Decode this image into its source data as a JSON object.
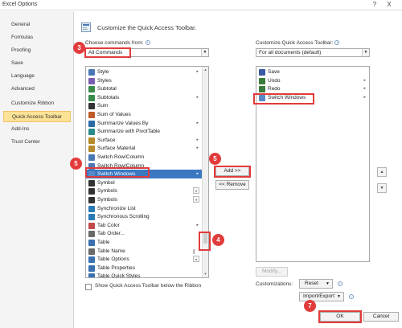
{
  "window": {
    "title": "Excel Options",
    "help_icon": "?",
    "close_icon": "X"
  },
  "sidebar": {
    "items": [
      {
        "label": "General"
      },
      {
        "label": "Formulas"
      },
      {
        "label": "Proofing"
      },
      {
        "label": "Save"
      },
      {
        "label": "Language"
      },
      {
        "label": "Advanced"
      },
      {
        "label": "Customize Ribbon"
      },
      {
        "label": "Quick Access Toolbar",
        "active": true
      },
      {
        "label": "Add-Ins"
      },
      {
        "label": "Trust Center"
      }
    ]
  },
  "header": {
    "title": "Customize the Quick Access Toolbar."
  },
  "left": {
    "choose_label": "Choose commands from:",
    "choose_value": "All Commands",
    "commands": [
      {
        "label": "Style",
        "icon": "style-icon",
        "sub": "▸"
      },
      {
        "label": "Styles",
        "icon": "styles-icon",
        "sub": ""
      },
      {
        "label": "Subtotal",
        "icon": "subtotal-icon",
        "sub": ""
      },
      {
        "label": "Subtotals",
        "icon": "subtotals-icon",
        "sub": "▸"
      },
      {
        "label": "Sum",
        "icon": "sum-icon",
        "sub": ""
      },
      {
        "label": "Sum of Values",
        "icon": "sum-values-icon",
        "sub": ""
      },
      {
        "label": "Summarize Values By",
        "icon": "summarize-icon",
        "sub": "▸"
      },
      {
        "label": "Summarize with PivotTable",
        "icon": "pivot-icon",
        "sub": ""
      },
      {
        "label": "Surface",
        "icon": "surface-icon",
        "sub": "▸"
      },
      {
        "label": "Surface Material",
        "icon": "surface-material-icon",
        "sub": "▸"
      },
      {
        "label": "Switch Row/Column",
        "icon": "switch-row-col-icon",
        "sub": ""
      },
      {
        "label": "Switch Row/Column",
        "icon": "switch-row-col-icon",
        "sub": ""
      },
      {
        "label": "Switch Windows",
        "icon": "switch-windows-icon",
        "sub": "▸",
        "selected": true
      },
      {
        "label": "Symbol",
        "icon": "symbol-icon",
        "sub": ""
      },
      {
        "label": "Symbols",
        "icon": "symbols-icon",
        "sub": "▾"
      },
      {
        "label": "Symbols",
        "icon": "symbols-icon",
        "sub": "▾"
      },
      {
        "label": "Synchronize List",
        "icon": "sync-list-icon",
        "sub": ""
      },
      {
        "label": "Synchronous Scrolling",
        "icon": "sync-scroll-icon",
        "sub": ""
      },
      {
        "label": "Tab Color",
        "icon": "tab-color-icon",
        "sub": "▸"
      },
      {
        "label": "Tab Order...",
        "icon": "tab-order-icon",
        "sub": ""
      },
      {
        "label": "Table",
        "icon": "table-icon",
        "sub": ""
      },
      {
        "label": "Table Name",
        "icon": "table-name-icon",
        "sub": ""
      },
      {
        "label": "Table Options",
        "icon": "table-options-icon",
        "sub": "▾"
      },
      {
        "label": "Table Properties",
        "icon": "table-properties-icon",
        "sub": ""
      },
      {
        "label": "Table Quick Styles",
        "icon": "table-styles-icon",
        "sub": ""
      }
    ],
    "show_below_label": "Show Quick Access Toolbar below the Ribbon"
  },
  "middle": {
    "add_label": "Add >>",
    "remove_label": "<< Remove"
  },
  "right": {
    "customize_label": "Customize Quick Access Toolbar:",
    "customize_value": "For all documents (default)",
    "items": [
      {
        "label": "Save",
        "icon": "save-icon",
        "sub": ""
      },
      {
        "label": "Undo",
        "icon": "undo-icon",
        "sub": "▸"
      },
      {
        "label": "Redo",
        "icon": "redo-icon",
        "sub": "▸"
      },
      {
        "label": "Switch Windows",
        "icon": "switch-windows-icon",
        "sub": "▸"
      }
    ],
    "modify_label": "Modify...",
    "customizations_label": "Customizations:",
    "reset_label": "Reset",
    "import_export_label": "Import/Export"
  },
  "footer": {
    "ok_label": "OK",
    "cancel_label": "Cancel"
  },
  "annotations": [
    {
      "number": "3"
    },
    {
      "number": "5"
    },
    {
      "number": "5"
    },
    {
      "number": "4"
    },
    {
      "number": "7"
    }
  ],
  "colors": {
    "annotation_red": "#e23b3b",
    "selection_blue": "#3a78c2",
    "active_sidebar": "#fbe296"
  }
}
